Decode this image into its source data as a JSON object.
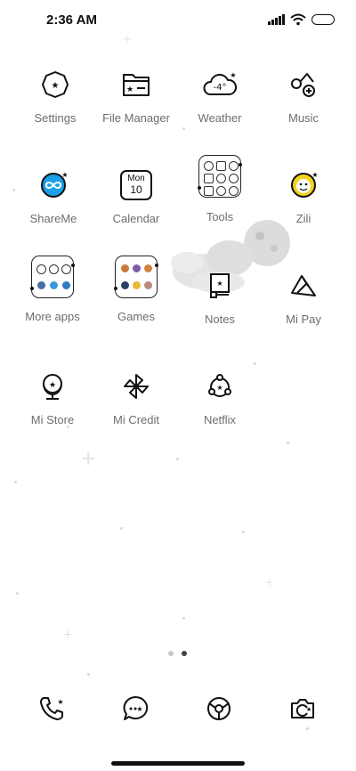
{
  "status_bar": {
    "time": "2:36 AM"
  },
  "apps": [
    {
      "label": "Settings",
      "icon": "settings-icon"
    },
    {
      "label": "File Manager",
      "icon": "folder-icon"
    },
    {
      "label": "Weather",
      "icon": "weather-cloud-icon",
      "temp": "-4°"
    },
    {
      "label": "Music",
      "icon": "music-icon"
    },
    {
      "label": "ShareMe",
      "icon": "shareme-icon"
    },
    {
      "label": "Calendar",
      "icon": "calendar-icon",
      "day_name": "Mon",
      "day_num": "10"
    },
    {
      "label": "Tools",
      "icon": "tools-folder-icon"
    },
    {
      "label": "Zili",
      "icon": "zili-icon"
    },
    {
      "label": "More apps",
      "icon": "more-apps-folder-icon"
    },
    {
      "label": "Games",
      "icon": "games-folder-icon"
    },
    {
      "label": "Notes",
      "icon": "notes-icon"
    },
    {
      "label": "Mi Pay",
      "icon": "mi-pay-icon"
    },
    {
      "label": "Mi Store",
      "icon": "mi-store-icon"
    },
    {
      "label": "Mi Credit",
      "icon": "pinwheel-icon"
    },
    {
      "label": "Netflix",
      "icon": "netflix-icon"
    }
  ],
  "dock": [
    {
      "icon": "phone-icon"
    },
    {
      "icon": "messages-icon"
    },
    {
      "icon": "browser-icon"
    },
    {
      "icon": "camera-icon"
    }
  ],
  "page_indicator": {
    "count": 2,
    "active": 2
  },
  "colors": {
    "accent_blue": "#1aa0e8",
    "zili_yellow": "#f2d21b",
    "icon_stroke": "#111111"
  }
}
